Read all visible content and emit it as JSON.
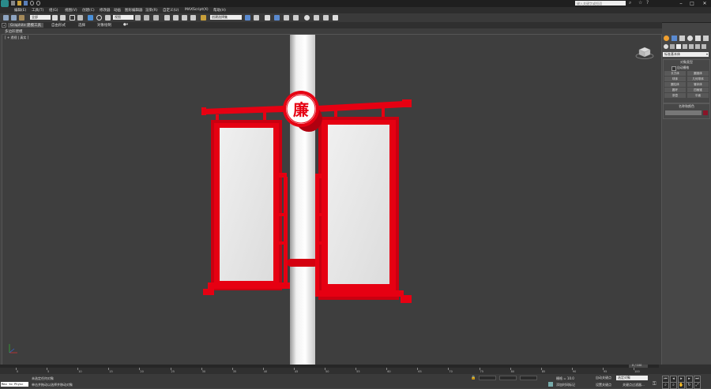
{
  "titlebar": {
    "search_placeholder": "键入关键字或短语",
    "window_controls": [
      "minimize-icon",
      "maximize-icon",
      "close-icon"
    ]
  },
  "menubar": {
    "items": [
      "编辑(E)",
      "工具(T)",
      "组(G)",
      "视图(V)",
      "创建(C)",
      "修改器",
      "动画",
      "图形编辑器",
      "渲染(R)",
      "自定义(U)",
      "MAXScript(X)",
      "帮助(H)"
    ]
  },
  "toolbar": {
    "selection_filter": "全部",
    "coordinate_system": "视图",
    "named_selection": "创建选择集"
  },
  "ribbon": {
    "tabs": [
      "Graphite 建模工具",
      "自由形式",
      "选择",
      "对象绘制"
    ],
    "sub_label": "多边形建模"
  },
  "viewport": {
    "label": "[ + 透视 | 真实 ]",
    "emblem_char": "廉",
    "colors": {
      "banner_red": "#e60012",
      "panel": "#e8e8e8",
      "pole": "#f2f2f2"
    }
  },
  "command_panel": {
    "dropdown": "标准基本体",
    "rollout_title": "对象类型",
    "autogrid": "自动栅格",
    "buttons": [
      "长方体",
      "圆锥体",
      "球体",
      "几何球体",
      "圆柱体",
      "管状体",
      "圆环",
      "四棱锥",
      "茶壶",
      "平面"
    ],
    "name_color_title": "名称和颜色",
    "object_color": "#8a1428"
  },
  "timeline": {
    "frame_indicator": "0 / 100",
    "ticks": [
      "0",
      "5",
      "10",
      "15",
      "20",
      "25",
      "30",
      "35",
      "40",
      "45",
      "50",
      "55",
      "60",
      "65",
      "70",
      "75",
      "80",
      "85",
      "90",
      "95",
      "100"
    ]
  },
  "statusbar": {
    "maxscript_label": "Max to Physc",
    "status_line1": "未选定任何对象",
    "status_line2": "单击并拖动以选择并移动对象",
    "grid_label": "栅格 = 10.0",
    "autokey_label": "自动关键点",
    "autokey_value": "选定对象",
    "setkey_label": "设置关键点",
    "keyfilter_label": "关键点过滤器...",
    "add_time_tag": "添加时间标记"
  }
}
